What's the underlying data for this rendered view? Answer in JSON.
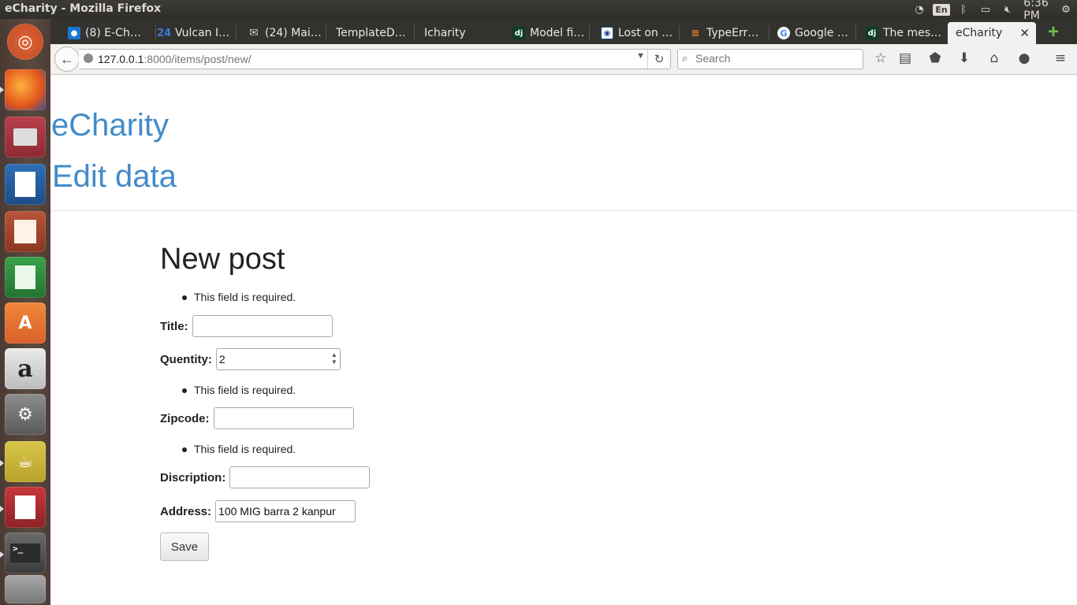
{
  "system": {
    "window_title": "eCharity - Mozilla Firefox",
    "keyboard": "En",
    "clock": "6:36 PM"
  },
  "tabs": [
    {
      "label": "(8) E-Ch…",
      "icon": "notification-icon"
    },
    {
      "label": "Vulcan I…",
      "icon": "site-icon"
    },
    {
      "label": "(24) Mai…",
      "icon": "mail-icon"
    },
    {
      "label": "TemplateD…",
      "icon": ""
    },
    {
      "label": "Icharity",
      "icon": ""
    },
    {
      "label": "Model fi…",
      "icon": "django-icon"
    },
    {
      "label": "Lost on …",
      "icon": "site-icon"
    },
    {
      "label": "TypeErr…",
      "icon": "stackoverflow-icon"
    },
    {
      "label": "Google …",
      "icon": "google-icon"
    },
    {
      "label": "The mes…",
      "icon": "django-icon"
    },
    {
      "label": "eCharity",
      "icon": "",
      "active": true
    }
  ],
  "navbar": {
    "url_host": "127.0.0.1",
    "url_path": ":8000/items/post/new/",
    "search_placeholder": "Search"
  },
  "page": {
    "site_title": "eCharity",
    "sub_title": "Edit data",
    "form_title": "New post",
    "errors": {
      "title": "This field is required.",
      "zipcode": "This field is required.",
      "discription": "This field is required."
    },
    "fields": {
      "title_label": "Title:",
      "title_value": "",
      "quantity_label": "Quentity:",
      "quantity_value": "2",
      "zipcode_label": "Zipcode:",
      "zipcode_value": "",
      "discription_label": "Discription:",
      "discription_value": "",
      "address_label": "Address:",
      "address_value": "100 MIG barra 2 kanpur"
    },
    "save_label": "Save"
  },
  "colors": {
    "link_blue": "#428bca",
    "panel_dark": "#3c3b37",
    "launcher_bg": "#5b4a3f"
  }
}
